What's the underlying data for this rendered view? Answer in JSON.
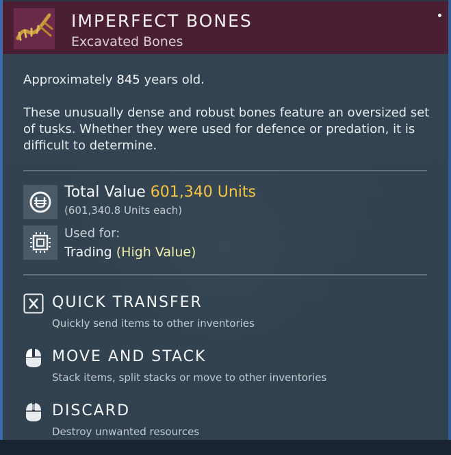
{
  "item": {
    "name": "IMPERFECT BONES",
    "category": "Excavated Bones",
    "age_prefix": "Approximately",
    "age_value": "845",
    "age_suffix": "years old.",
    "description": "These unusually dense and robust bones feature an oversized set of tusks. Whether they were used for defence or predation, it is difficult to determine."
  },
  "value": {
    "label": "Total Value",
    "amount": "601,340 Units",
    "each": "(601,340.8 Units each)"
  },
  "usage": {
    "label": "Used for:",
    "purpose": "Trading",
    "qualifier": "(High Value)"
  },
  "actions": [
    {
      "icon": "x-key-icon",
      "title": "QUICK TRANSFER",
      "desc": "Quickly send items to other inventories"
    },
    {
      "icon": "mouse-icon",
      "title": "MOVE AND STACK",
      "desc": "Stack items, split stacks or move to other inventories"
    },
    {
      "icon": "mouse-icon",
      "title": "DISCARD",
      "desc": "Destroy unwanted resources"
    }
  ],
  "colors": {
    "header_bg": "#4a1e33",
    "value_accent": "#f5c441",
    "qualifier_accent": "#f1f0a8"
  }
}
